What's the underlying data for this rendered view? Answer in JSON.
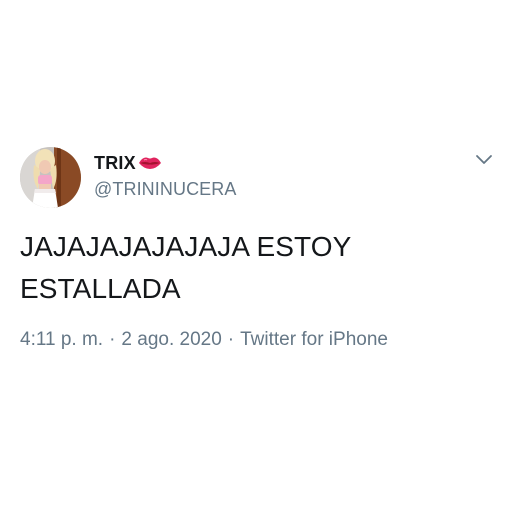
{
  "tweet": {
    "author": {
      "display_name": "TRIX",
      "name_emoji": "lips-kiss-icon",
      "handle": "@TRININUCERA"
    },
    "text_lines": [
      "JAJAJAJAJAJAJA ESTOY",
      "ESTALLADA"
    ],
    "time": "4:11 p. m.",
    "date": "2 ago. 2020",
    "source": "Twitter for iPhone",
    "separator": "·",
    "menu_icon": "chevron-down-icon"
  },
  "colors": {
    "primary_text": "#14171a",
    "secondary_text": "#657786",
    "caret": "#657786",
    "lips": "#e0245e"
  }
}
